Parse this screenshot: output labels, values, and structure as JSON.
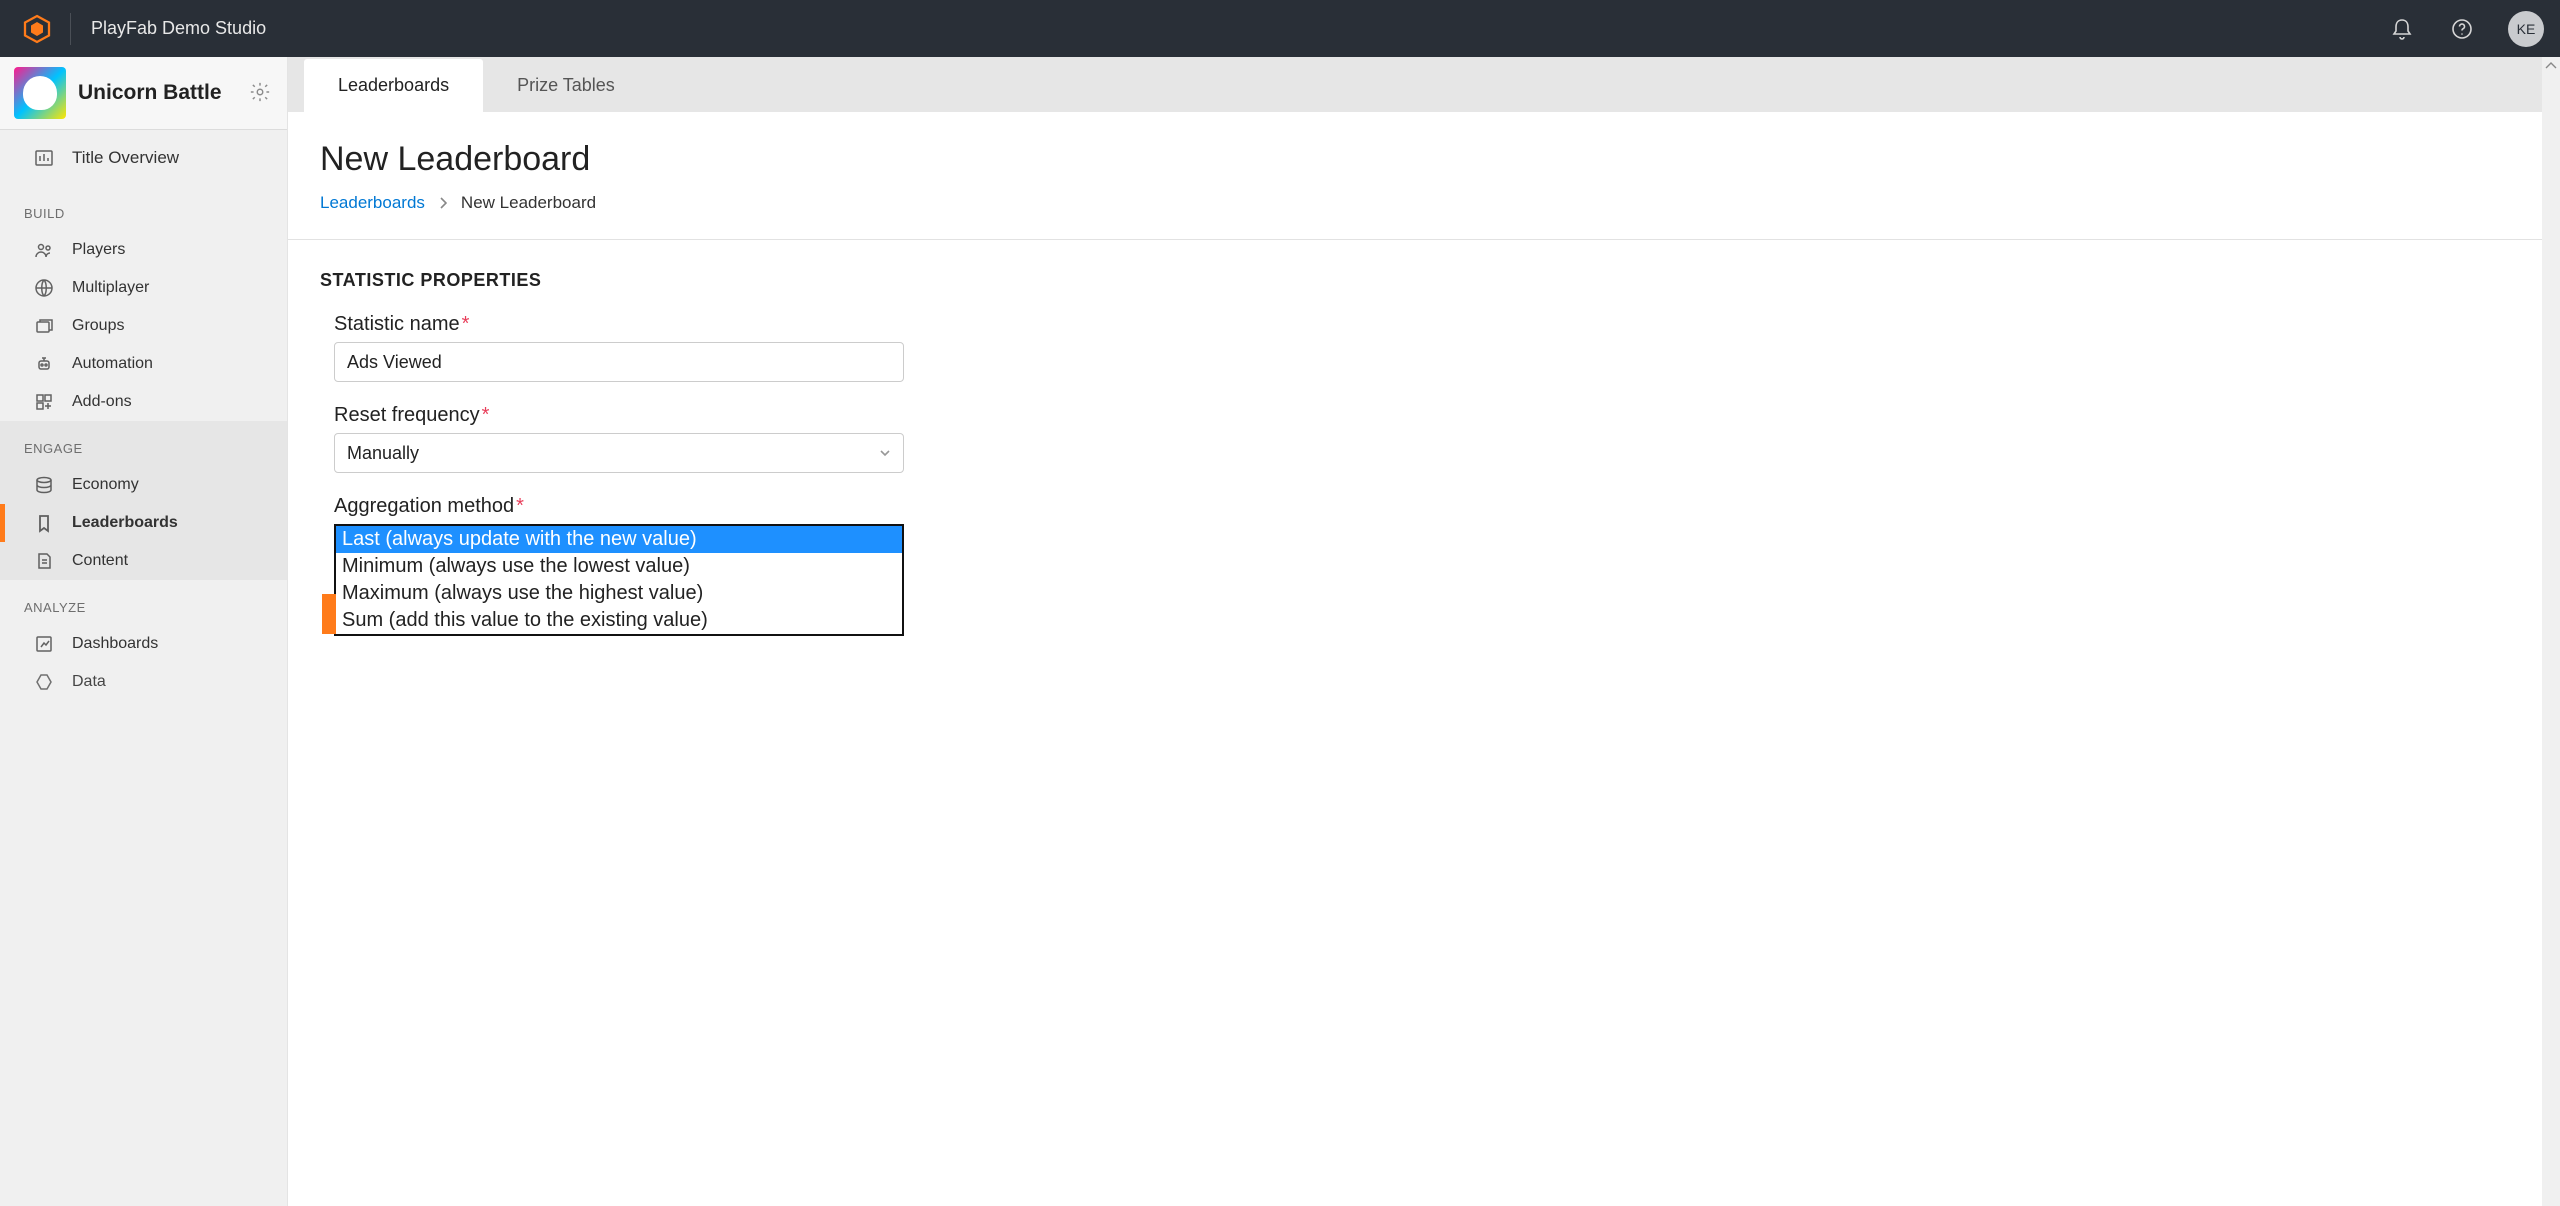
{
  "header": {
    "studio_name": "PlayFab Demo Studio",
    "avatar_initials": "KE"
  },
  "game": {
    "title": "Unicorn Battle"
  },
  "sidebar": {
    "overview_label": "Title Overview",
    "sections": {
      "build": {
        "title": "BUILD",
        "items": [
          "Players",
          "Multiplayer",
          "Groups",
          "Automation",
          "Add-ons"
        ]
      },
      "engage": {
        "title": "ENGAGE",
        "items": [
          "Economy",
          "Leaderboards",
          "Content"
        ]
      },
      "analyze": {
        "title": "ANALYZE",
        "items": [
          "Dashboards",
          "Data"
        ]
      }
    }
  },
  "tabs": {
    "leaderboards": "Leaderboards",
    "prize_tables": "Prize Tables"
  },
  "page": {
    "title": "New Leaderboard",
    "breadcrumb_root": "Leaderboards",
    "breadcrumb_current": "New Leaderboard"
  },
  "form": {
    "section_title": "STATISTIC PROPERTIES",
    "statistic_name": {
      "label": "Statistic name",
      "value": "Ads Viewed"
    },
    "reset_frequency": {
      "label": "Reset frequency",
      "value": "Manually"
    },
    "aggregation": {
      "label": "Aggregation method",
      "options": [
        "Last (always update with the new value)",
        "Minimum (always use the lowest value)",
        "Maximum (always use the highest value)",
        "Sum (add this value to the existing value)"
      ],
      "selected_index": 0
    }
  }
}
